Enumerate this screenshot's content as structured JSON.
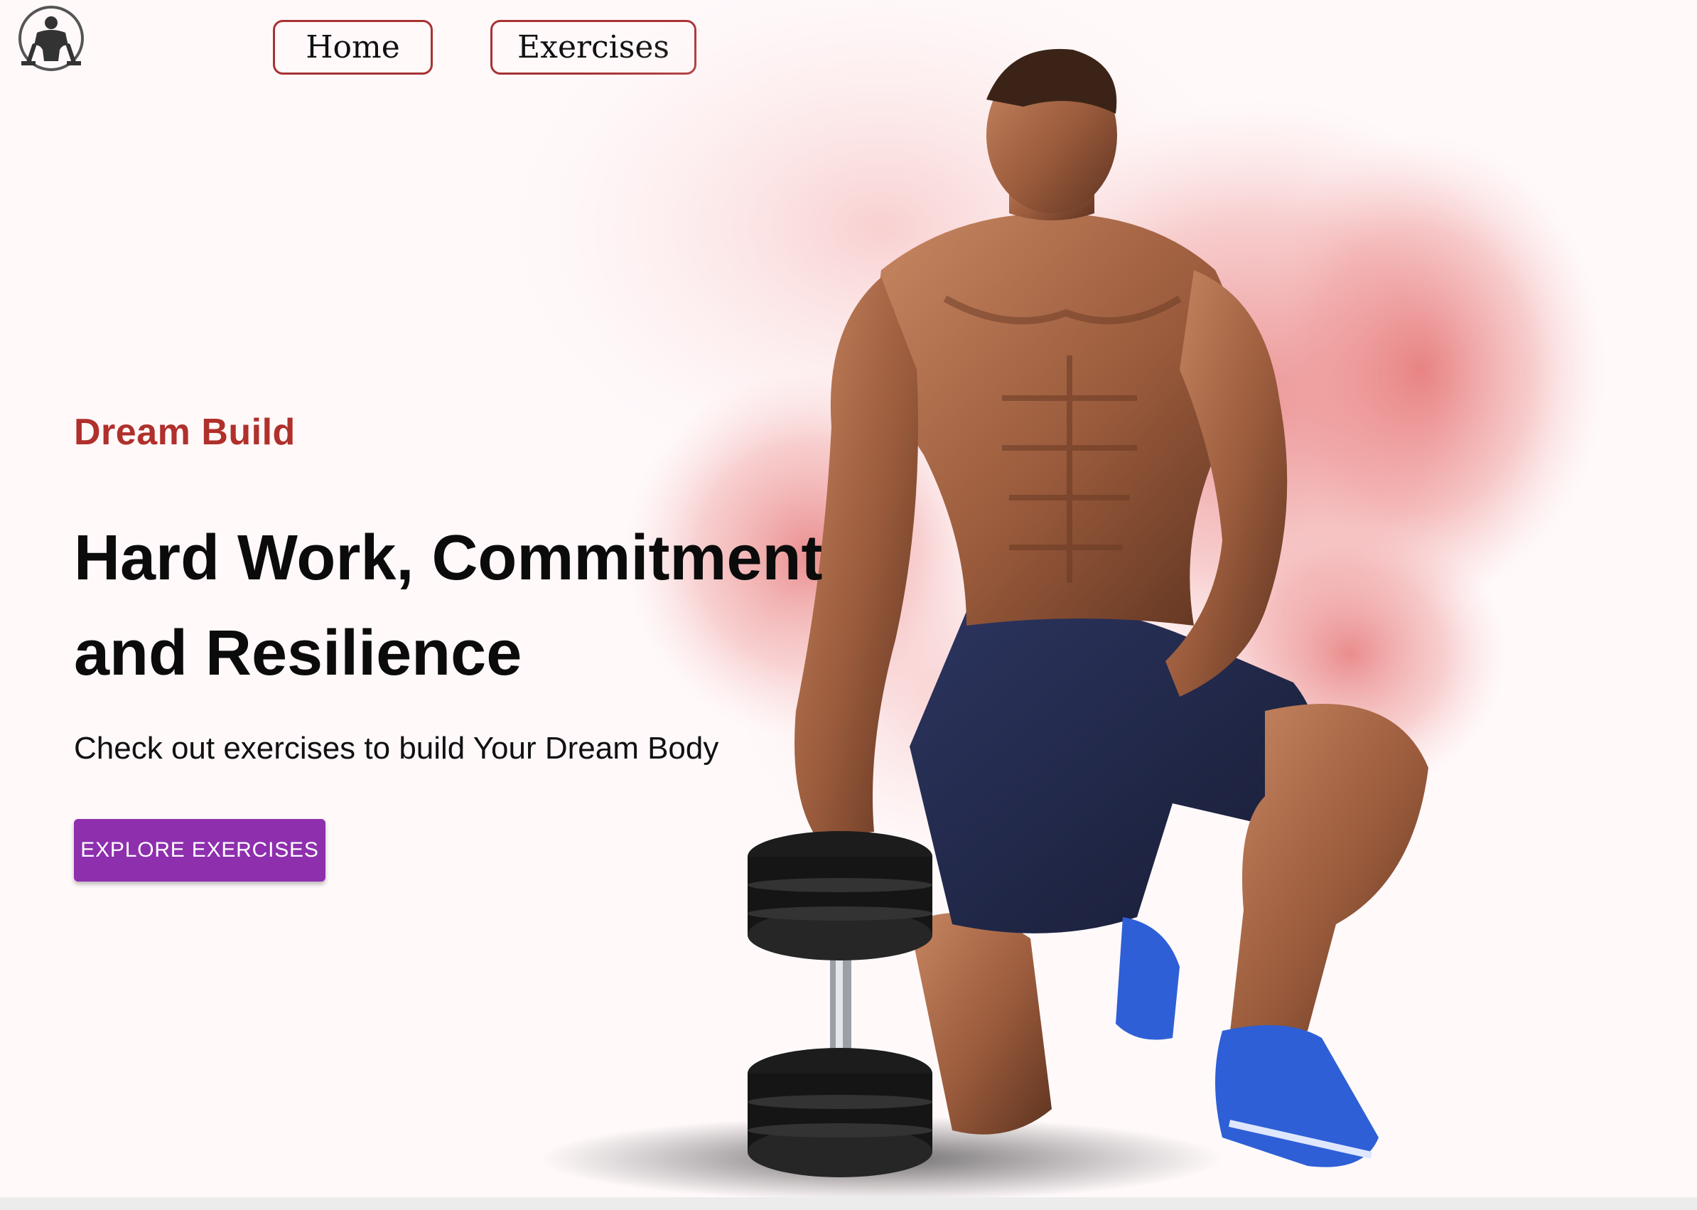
{
  "nav": {
    "logo_icon": "gym-bodybuilder-logo-icon",
    "home_label": "Home",
    "exercises_label": "Exercises"
  },
  "hero": {
    "eyebrow": "Dream Build",
    "headline_line1": "Hard Work, Commitment",
    "headline_line2": "and Resilience",
    "subtext": "Check out exercises to build Your Dream Body",
    "cta_label": "EXPLORE EXERCISES",
    "image_subject": "athlete-kneeling-with-dumbbell-image"
  },
  "colors": {
    "background": "#fff9fa",
    "accent_red": "#b0302b",
    "nav_border": "#a83232",
    "cta_purple": "#8e2fae",
    "smoke_red": "#e07070"
  }
}
